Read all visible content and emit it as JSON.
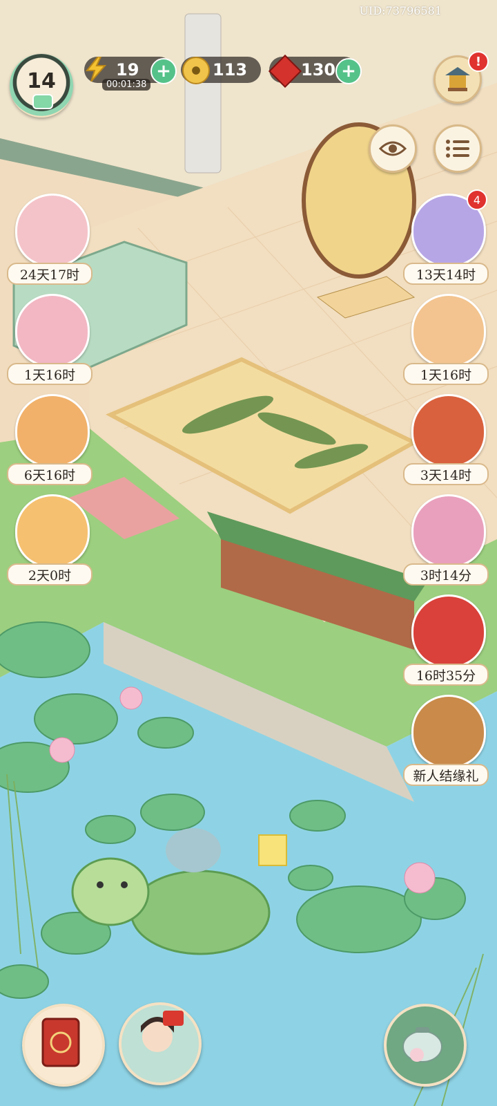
{
  "hud": {
    "uid": "UID:73796581",
    "level": "14",
    "energy": "19",
    "energy_timer": "00:01:38",
    "coins": "113",
    "gems": "130"
  },
  "buttons": {
    "notice_badge": "!"
  },
  "left_events": [
    {
      "label": "24天17时",
      "color": "#f4c3c9"
    },
    {
      "label": "1天16时",
      "color": "#f2b7c3"
    },
    {
      "label": "6天16时",
      "color": "#f1b16a"
    },
    {
      "label": "2天0时",
      "color": "#f5c070"
    }
  ],
  "right_events": [
    {
      "label": "13天14时",
      "color": "#b7a6e6",
      "count": "4"
    },
    {
      "label": "1天16时",
      "color": "#f3c48f"
    },
    {
      "label": "3天14时",
      "color": "#d9613d"
    },
    {
      "label": "3时14分",
      "color": "#e9a0bd"
    },
    {
      "label": "16时35分",
      "color": "#d9413a"
    },
    {
      "label": "新人结缘礼",
      "color": "#c98a4a"
    }
  ],
  "colors": {
    "plus_button": "#55c28a",
    "water": "#8ed3e5",
    "lily_pad": "#6fbe86",
    "floor": "#f1dcbf",
    "badge_red": "#e0322f"
  }
}
